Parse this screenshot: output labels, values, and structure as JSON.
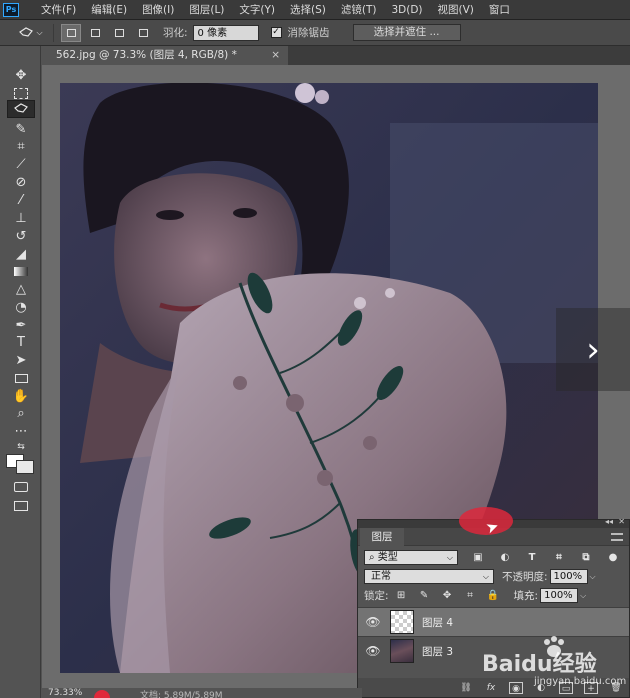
{
  "app": {
    "logo": "Ps"
  },
  "menu": [
    "文件(F)",
    "编辑(E)",
    "图像(I)",
    "图层(L)",
    "文字(Y)",
    "选择(S)",
    "滤镜(T)",
    "3D(D)",
    "视图(V)",
    "窗口"
  ],
  "options": {
    "feather_label": "羽化:",
    "feather_value": "0 像素",
    "antialias_label": "消除锯齿",
    "antialias_checked": true,
    "select_mask_button": "选择并遮住 ..."
  },
  "document": {
    "tab_title": "562.jpg @ 73.3% (图层 4, RGB/8) *",
    "close": "×"
  },
  "layers_panel": {
    "tab_label": "图层",
    "filter_kind": "类型",
    "blend_mode": "正常",
    "opacity_label": "不透明度:",
    "opacity_value": "100%",
    "lock_label": "锁定:",
    "fill_label": "填充:",
    "fill_value": "100%",
    "layers": [
      {
        "name": "图层 4",
        "visible": true,
        "selected": true,
        "thumb": "transparent"
      },
      {
        "name": "图层 3",
        "visible": true,
        "selected": false,
        "thumb": "photo"
      }
    ]
  },
  "status": {
    "zoom": "73.33%",
    "doc_info": "文档: 5.89M/5.89M"
  },
  "watermark": {
    "brand": "Baidu经验",
    "site": "jingyan.baidu.com"
  },
  "colors": {
    "accent": "#31a8ff",
    "panel": "#535353",
    "menubar": "#3a3a3a",
    "canvas_bg": "#6c6c6c",
    "rec_dot": "#e0283a"
  }
}
